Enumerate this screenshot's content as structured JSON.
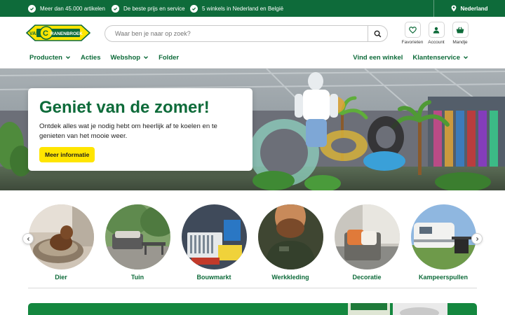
{
  "topbar": {
    "usps": [
      "Meer dan 45.000 artikelen",
      "De beste prijs en service",
      "5 winkels in Nederland en België"
    ],
    "country": "Nederland"
  },
  "brand": {
    "logo_text": "VAN CRANENBROEK",
    "colors": {
      "primary": "#0e6b3a",
      "accent": "#ffe500",
      "promo": "#14873f"
    }
  },
  "search": {
    "placeholder": "Waar ben je naar op zoek?",
    "icon": "search-icon"
  },
  "header_icons": [
    {
      "label": "Favorieten",
      "icon": "heart-icon"
    },
    {
      "label": "Account",
      "icon": "user-icon"
    },
    {
      "label": "Mandje",
      "icon": "basket-icon"
    }
  ],
  "nav": {
    "left": [
      {
        "label": "Producten",
        "dropdown": true
      },
      {
        "label": "Acties",
        "dropdown": false
      },
      {
        "label": "Webshop",
        "dropdown": true
      },
      {
        "label": "Folder",
        "dropdown": false
      }
    ],
    "right": [
      {
        "label": "Vind een winkel",
        "dropdown": false
      },
      {
        "label": "Klantenservice",
        "dropdown": true
      }
    ]
  },
  "hero": {
    "title": "Geniet van de zomer!",
    "text": "Ontdek alles wat je nodig hebt om heerlijk af te koelen en te genieten van het mooie weer.",
    "button": "Meer informatie"
  },
  "categories": [
    "Dier",
    "Tuin",
    "Bouwmarkt",
    "Werkkleding",
    "Decoratie",
    "Kampeerspullen"
  ]
}
